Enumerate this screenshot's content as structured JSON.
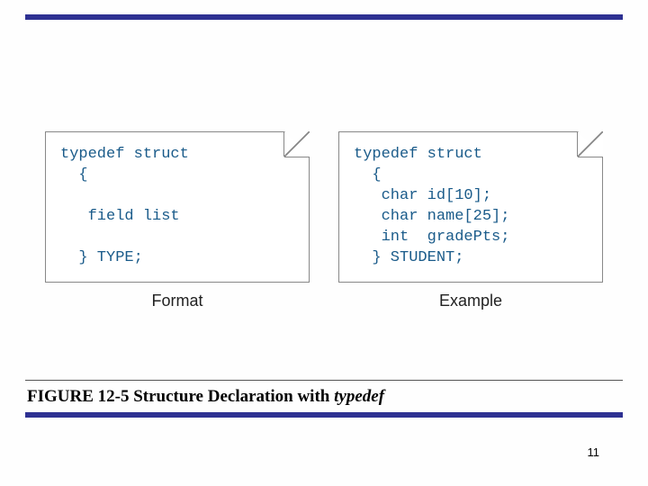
{
  "figure": {
    "boxes": [
      {
        "label": "Format",
        "code": "typedef struct\n  {\n\n   field list\n\n  } TYPE;"
      },
      {
        "label": "Example",
        "code": "typedef struct\n  {\n   char id[10];\n   char name[25];\n   int  gradePts;\n  } STUDENT;"
      }
    ]
  },
  "caption": {
    "number": "FIGURE 12-5",
    "title": "Structure Declaration with",
    "keyword": "typedef"
  },
  "page_number": "11"
}
